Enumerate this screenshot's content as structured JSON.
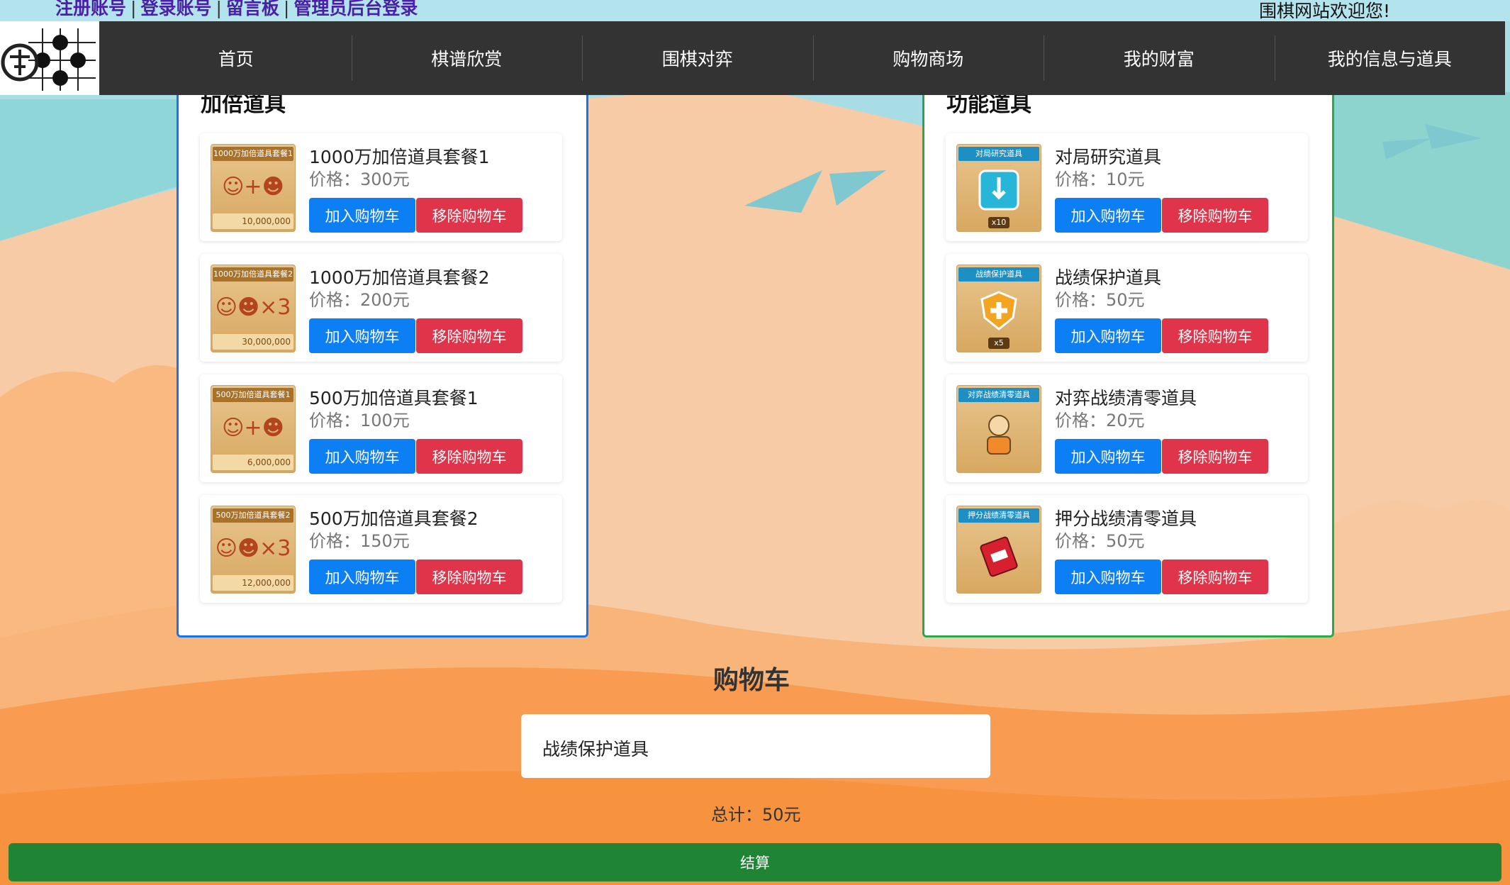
{
  "header": {
    "links": [
      "注册账号",
      "登录账号",
      "留言板",
      "管理员后台登录"
    ],
    "separator": "|",
    "welcome": "围棋网站欢迎您!"
  },
  "nav": {
    "items": [
      "首页",
      "棋谱欣赏",
      "围棋对弈",
      "购物商场",
      "我的财富",
      "我的信息与道具"
    ]
  },
  "colors": {
    "nav_bg": "#333333",
    "add_button": "#0d7ff5",
    "remove_button": "#e0344a",
    "left_panel_border": "#1a73e8",
    "right_panel_border": "#2aa84a",
    "checkout": "#1f8534"
  },
  "panels": [
    {
      "title": "加倍道具",
      "items": [
        {
          "name": "1000万加倍道具套餐1",
          "price": "价格：300元",
          "thumb_title": "1000万加倍道具套餐1",
          "thumb_amount": "10,000,000",
          "add": "加入购物车",
          "remove": "移除购物车"
        },
        {
          "name": "1000万加倍道具套餐2",
          "price": "价格：200元",
          "thumb_title": "1000万加倍道具套餐2",
          "thumb_amount": "30,000,000",
          "add": "加入购物车",
          "remove": "移除购物车"
        },
        {
          "name": "500万加倍道具套餐1",
          "price": "价格：100元",
          "thumb_title": "500万加倍道具套餐1",
          "thumb_amount": "6,000,000",
          "add": "加入购物车",
          "remove": "移除购物车"
        },
        {
          "name": "500万加倍道具套餐2",
          "price": "价格：150元",
          "thumb_title": "500万加倍道具套餐2",
          "thumb_amount": "12,000,000",
          "add": "加入购物车",
          "remove": "移除购物车"
        }
      ]
    },
    {
      "title": "功能道具",
      "items": [
        {
          "name": "对局研究道具",
          "price": "价格：10元",
          "thumb_title": "对局研究道具",
          "thumb_badge": "x10",
          "add": "加入购物车",
          "remove": "移除购物车"
        },
        {
          "name": "战绩保护道具",
          "price": "价格：50元",
          "thumb_title": "战绩保护道具",
          "thumb_badge": "x5",
          "add": "加入购物车",
          "remove": "移除购物车"
        },
        {
          "name": "对弈战绩清零道具",
          "price": "价格：20元",
          "thumb_title": "对弈战绩清零道具",
          "add": "加入购物车",
          "remove": "移除购物车"
        },
        {
          "name": "押分战绩清零道具",
          "price": "价格：50元",
          "thumb_title": "押分战绩清零道具",
          "add": "加入购物车",
          "remove": "移除购物车"
        }
      ]
    }
  ],
  "cart": {
    "title": "购物车",
    "items": [
      "战绩保护道具"
    ],
    "total": "总计：50元",
    "checkout": "结算"
  }
}
